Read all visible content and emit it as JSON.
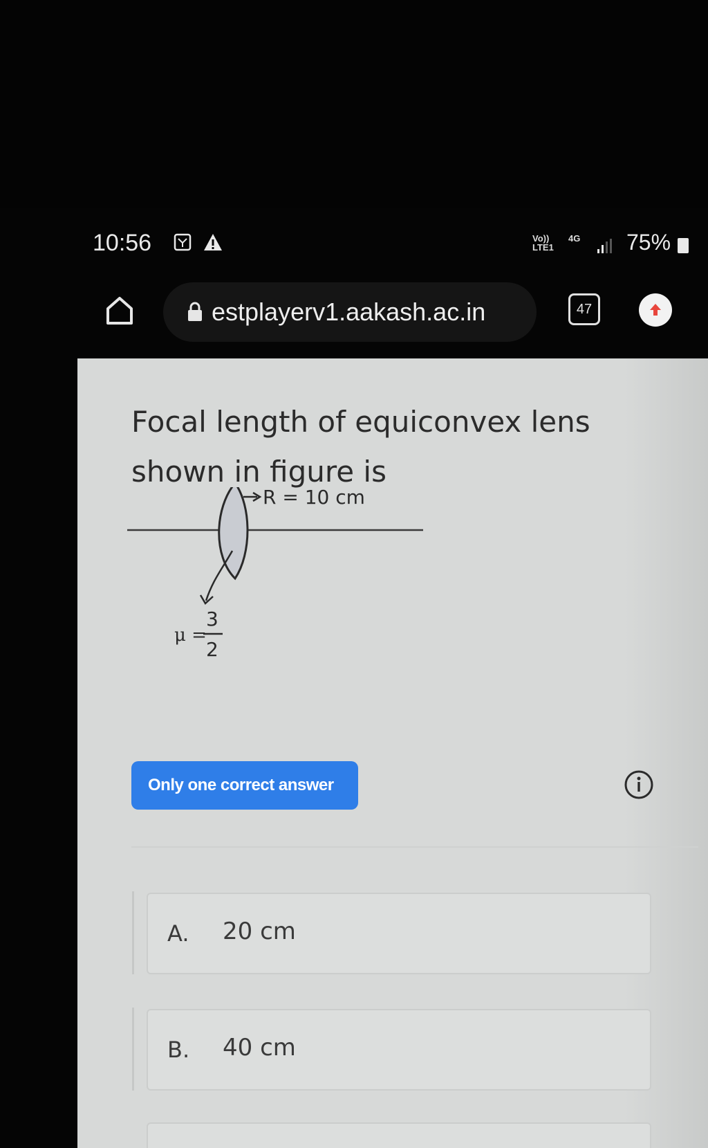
{
  "status_bar": {
    "time": "10:56",
    "network_volte": "Vo)) LTE1",
    "network_4g": "4G",
    "battery": "75%"
  },
  "browser": {
    "url": "estplayerv1.aakash.ac.in",
    "tab_count": "47"
  },
  "question": {
    "text": "Focal length of equiconvex lens shown in figure is",
    "figure": {
      "radius_label": "R = 10 cm",
      "mu_symbol": "μ =",
      "mu_numerator": "3",
      "mu_denominator": "2"
    }
  },
  "answer_type": "Only one correct answer",
  "options": [
    {
      "letter": "A.",
      "text": "20 cm"
    },
    {
      "letter": "B.",
      "text": "40 cm"
    }
  ],
  "colors": {
    "badge_blue": "#2f7ee8",
    "page_background": "#d7d9d8"
  }
}
